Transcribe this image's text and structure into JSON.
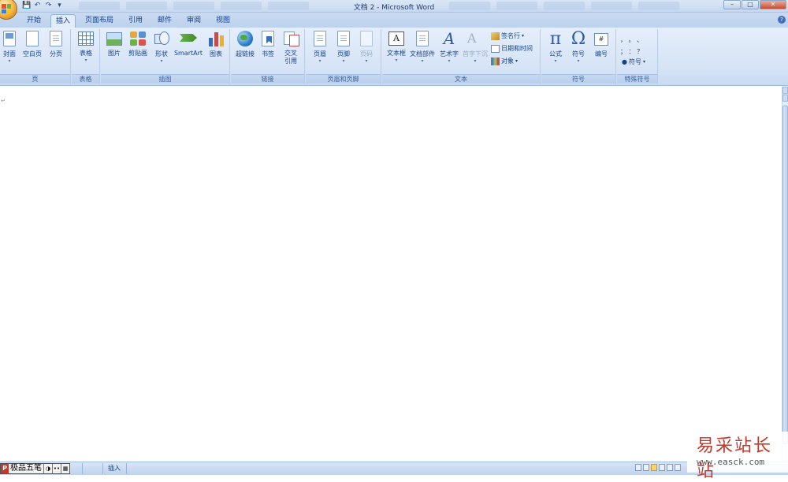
{
  "window": {
    "title": "文档 2 - Microsoft Word",
    "minimize": "–",
    "maximize": "□",
    "close": "✕"
  },
  "qat": {
    "save": "💾",
    "undo": "↶",
    "redo": "↷",
    "more": "▾"
  },
  "tabs": [
    {
      "label": "开始",
      "active": false
    },
    {
      "label": "插入",
      "active": true
    },
    {
      "label": "页面布局",
      "active": false
    },
    {
      "label": "引用",
      "active": false
    },
    {
      "label": "邮件",
      "active": false
    },
    {
      "label": "审阅",
      "active": false
    },
    {
      "label": "视图",
      "active": false
    }
  ],
  "help": "?",
  "ribbon": {
    "groups": {
      "pages": "页",
      "tables": "表格",
      "illustrations": "插图",
      "links": "链接",
      "header_footer": "页眉和页脚",
      "text": "文本",
      "symbols": "符号",
      "special": "特殊符号"
    },
    "buttons": {
      "cover": "封面",
      "blank": "空白页",
      "pagebreak": "分页",
      "table": "表格",
      "picture": "图片",
      "clipart": "剪贴画",
      "shapes": "形状",
      "smartart": "SmartArt",
      "chart": "图表",
      "hyperlink": "超链接",
      "bookmark": "书签",
      "xref_1": "交叉",
      "xref_2": "引用",
      "header": "页眉",
      "footer": "页脚",
      "pagenum": "页码",
      "textbox": "文本框",
      "quickparts": "文档部件",
      "wordart": "艺术字",
      "dropcap": "首字下沉",
      "signature": "签名行",
      "datetime": "日期和时间",
      "object": "对象",
      "equation": "公式",
      "symbol": "符号",
      "numbering": "编号",
      "special_symbol": "符号"
    },
    "glyphs": {
      "textbox": "A",
      "wordart": "A",
      "dropcap": "A",
      "pi": "π",
      "omega": "Ω",
      "numbering": "#",
      "arrow": "▾",
      "special_row1": "，  。  、",
      "special_row2": "；  ：  ？"
    }
  },
  "document": {
    "paragraph_mark": "↵"
  },
  "statusbar": {
    "ime_name": "极品五笔",
    "ime_p": "P",
    "ime_moon": "◑",
    "ime_dots": "••",
    "ime_kbd": "▦",
    "mode": "插入"
  },
  "watermark": {
    "cn": "易采站长站",
    "url": "www.easck.com"
  },
  "colors": {
    "ribbon_bg": "#dbe7f6",
    "accent": "#15428b",
    "watermark_red": "#c0392b"
  }
}
